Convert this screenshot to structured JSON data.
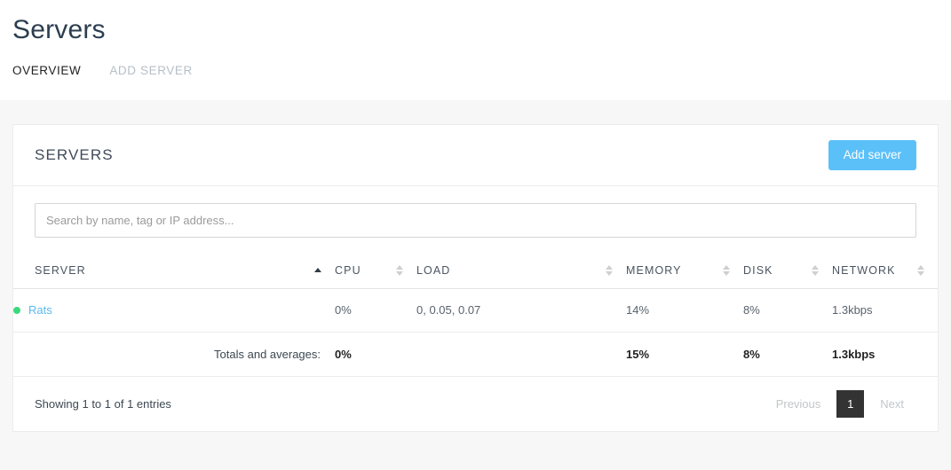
{
  "page": {
    "title": "Servers",
    "tabs": [
      {
        "label": "OVERVIEW",
        "active": true
      },
      {
        "label": "ADD SERVER",
        "active": false
      }
    ]
  },
  "card": {
    "title": "SERVERS",
    "add_button_label": "Add server"
  },
  "search": {
    "value": "",
    "placeholder": "Search by name, tag or IP address..."
  },
  "table": {
    "columns": [
      {
        "label": "SERVER",
        "sort": "asc"
      },
      {
        "label": "CPU",
        "sort": "none"
      },
      {
        "label": "LOAD",
        "sort": "none"
      },
      {
        "label": "MEMORY",
        "sort": "none"
      },
      {
        "label": "DISK",
        "sort": "none"
      },
      {
        "label": "NETWORK",
        "sort": "none"
      }
    ],
    "rows": [
      {
        "status": "online",
        "name": "Rats",
        "cpu": "0%",
        "load": "0, 0.05, 0.07",
        "memory": "14%",
        "disk": "8%",
        "network": "1.3kbps"
      }
    ],
    "totals": {
      "label": "Totals and averages:",
      "cpu": "0%",
      "load": "",
      "memory": "15%",
      "disk": "8%",
      "network": "1.3kbps"
    }
  },
  "footer": {
    "showing": "Showing 1 to 1 of 1 entries",
    "previous_label": "Previous",
    "current_page": "1",
    "next_label": "Next"
  },
  "colors": {
    "accent_blue": "#5bc0f8",
    "link_blue": "#5bb8f2",
    "status_green": "#3ad97d",
    "title_navy": "#2c3e50",
    "page_bg": "#f7f7f7",
    "pagination_active_bg": "#333333"
  }
}
